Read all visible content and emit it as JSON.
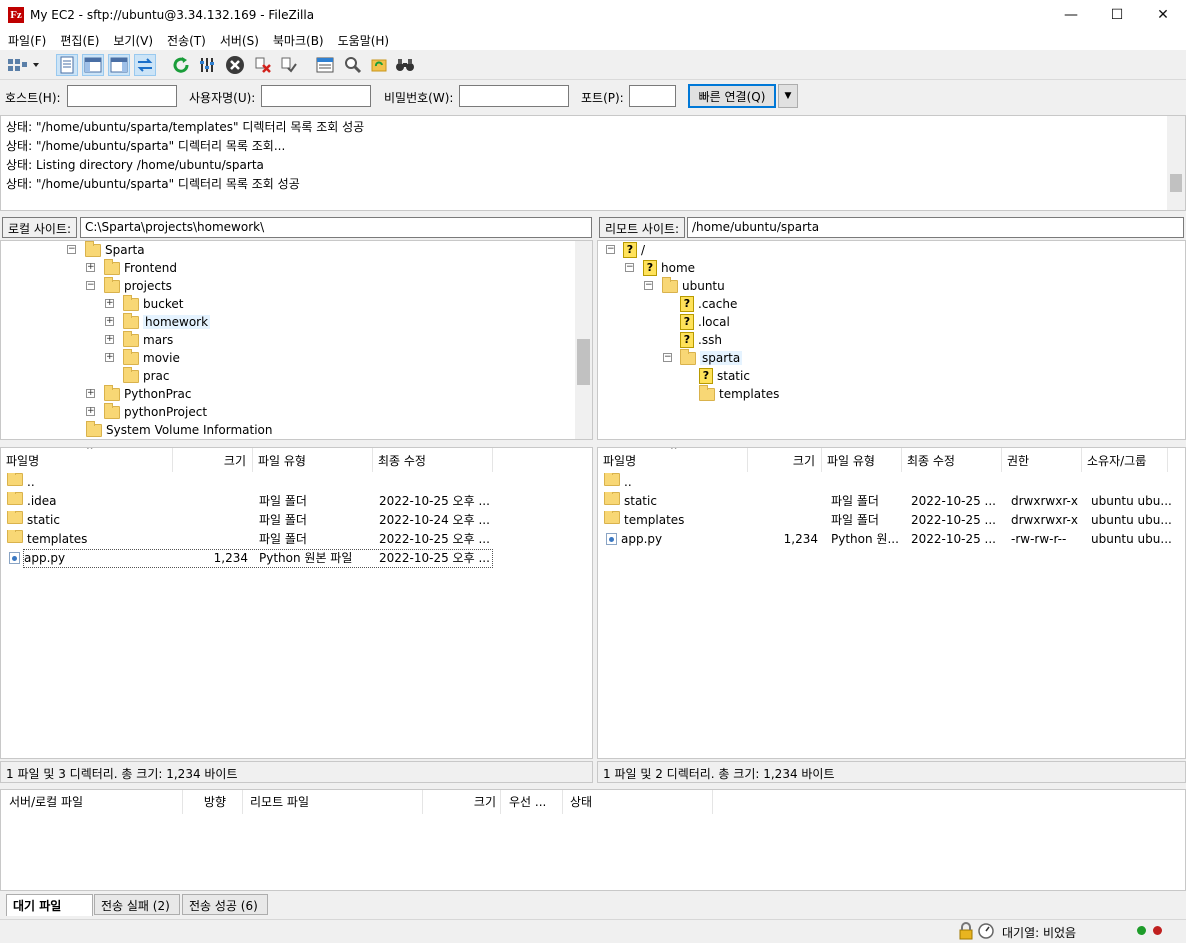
{
  "window": {
    "title": "My EC2 - sftp://ubuntu@3.34.132.169 - FileZilla",
    "app_icon": "Fz",
    "minimize_glyph": "—",
    "maximize_glyph": "☐",
    "close_glyph": "✕"
  },
  "menu": [
    "파일(F)",
    "편집(E)",
    "보기(V)",
    "전송(T)",
    "서버(S)",
    "북마크(B)",
    "도움말(H)"
  ],
  "toolbar": {
    "buttons": [
      "site-manager-icon",
      "toggle-log-icon",
      "toggle-local-tree-icon",
      "toggle-remote-tree-icon",
      "toggle-queue-icon",
      "refresh-icon",
      "process-queue-icon",
      "cancel-icon",
      "disconnect-icon",
      "reconnect-icon",
      "filter-icon",
      "compare-icon",
      "sync-browse-icon",
      "search-icon"
    ]
  },
  "quickconnect": {
    "host_label": "호스트(H):",
    "user_label": "사용자명(U):",
    "pass_label": "비밀번호(W):",
    "port_label": "포트(P):",
    "host_value": "",
    "user_value": "",
    "pass_value": "",
    "port_value": "",
    "connect_label": "빠른 연결(Q)",
    "dropdown_glyph": "▼"
  },
  "log": [
    "상태:\t\"/home/ubuntu/sparta/templates\" 디렉터리 목록 조회 성공",
    "상태:\t\"/home/ubuntu/sparta\" 디렉터리 목록 조회...",
    "상태:\tListing directory /home/ubuntu/sparta",
    "상태:\t\"/home/ubuntu/sparta\" 디렉터리 목록 조회 성공"
  ],
  "local": {
    "site_label": "로컬 사이트:",
    "path": "C:\\Sparta\\projects\\homework\\",
    "tree": [
      "Sparta",
      "Frontend",
      "projects",
      "bucket",
      "homework",
      "mars",
      "movie",
      "prac",
      "PythonPrac",
      "pythonProject",
      "System Volume Information"
    ],
    "columns": [
      "파일명",
      "크기",
      "파일 유형",
      "최종 수정"
    ],
    "files": [
      {
        "name": "..",
        "size": "",
        "type": "",
        "modified": ""
      },
      {
        "name": ".idea",
        "size": "",
        "type": "파일 폴더",
        "modified": "2022-10-25 오후 ..."
      },
      {
        "name": "static",
        "size": "",
        "type": "파일 폴더",
        "modified": "2022-10-24 오후 ..."
      },
      {
        "name": "templates",
        "size": "",
        "type": "파일 폴더",
        "modified": "2022-10-25 오후 ..."
      },
      {
        "name": "app.py",
        "size": "1,234",
        "type": "Python 원본 파일",
        "modified": "2022-10-25 오후 ..."
      }
    ],
    "status": "1 파일 및 3 디렉터리. 총 크기: 1,234 바이트"
  },
  "remote": {
    "site_label": "리모트 사이트:",
    "path": "/home/ubuntu/sparta",
    "tree": [
      "/",
      "home",
      "ubuntu",
      ".cache",
      ".local",
      ".ssh",
      "sparta",
      "static",
      "templates"
    ],
    "columns": [
      "파일명",
      "크기",
      "파일 유형",
      "최종 수정",
      "권한",
      "소유자/그룹"
    ],
    "files": [
      {
        "name": "..",
        "size": "",
        "type": "",
        "modified": "",
        "perm": "",
        "owner": ""
      },
      {
        "name": "static",
        "size": "",
        "type": "파일 폴더",
        "modified": "2022-10-25 ...",
        "perm": "drwxrwxr-x",
        "owner": "ubuntu ubu..."
      },
      {
        "name": "templates",
        "size": "",
        "type": "파일 폴더",
        "modified": "2022-10-25 ...",
        "perm": "drwxrwxr-x",
        "owner": "ubuntu ubu..."
      },
      {
        "name": "app.py",
        "size": "1,234",
        "type": "Python 원...",
        "modified": "2022-10-25 ...",
        "perm": "-rw-rw-r--",
        "owner": "ubuntu ubu..."
      }
    ],
    "status": "1 파일 및 2 디렉터리. 총 크기: 1,234 바이트"
  },
  "queue": {
    "columns": [
      "서버/로컬 파일",
      "방향",
      "리모트 파일",
      "크기",
      "우선 ...",
      "상태"
    ],
    "tabs": [
      "대기 파일",
      "전송 실패 (2)",
      "전송 성공 (6)"
    ]
  },
  "statusbar": {
    "queue_text": "대기열: 비었음",
    "led_colors": [
      "#1e9c2a",
      "#c0201f"
    ]
  },
  "colors": {
    "accent": "#0078d7",
    "folder": "#f8d775",
    "selection": "#e5f3ff"
  }
}
